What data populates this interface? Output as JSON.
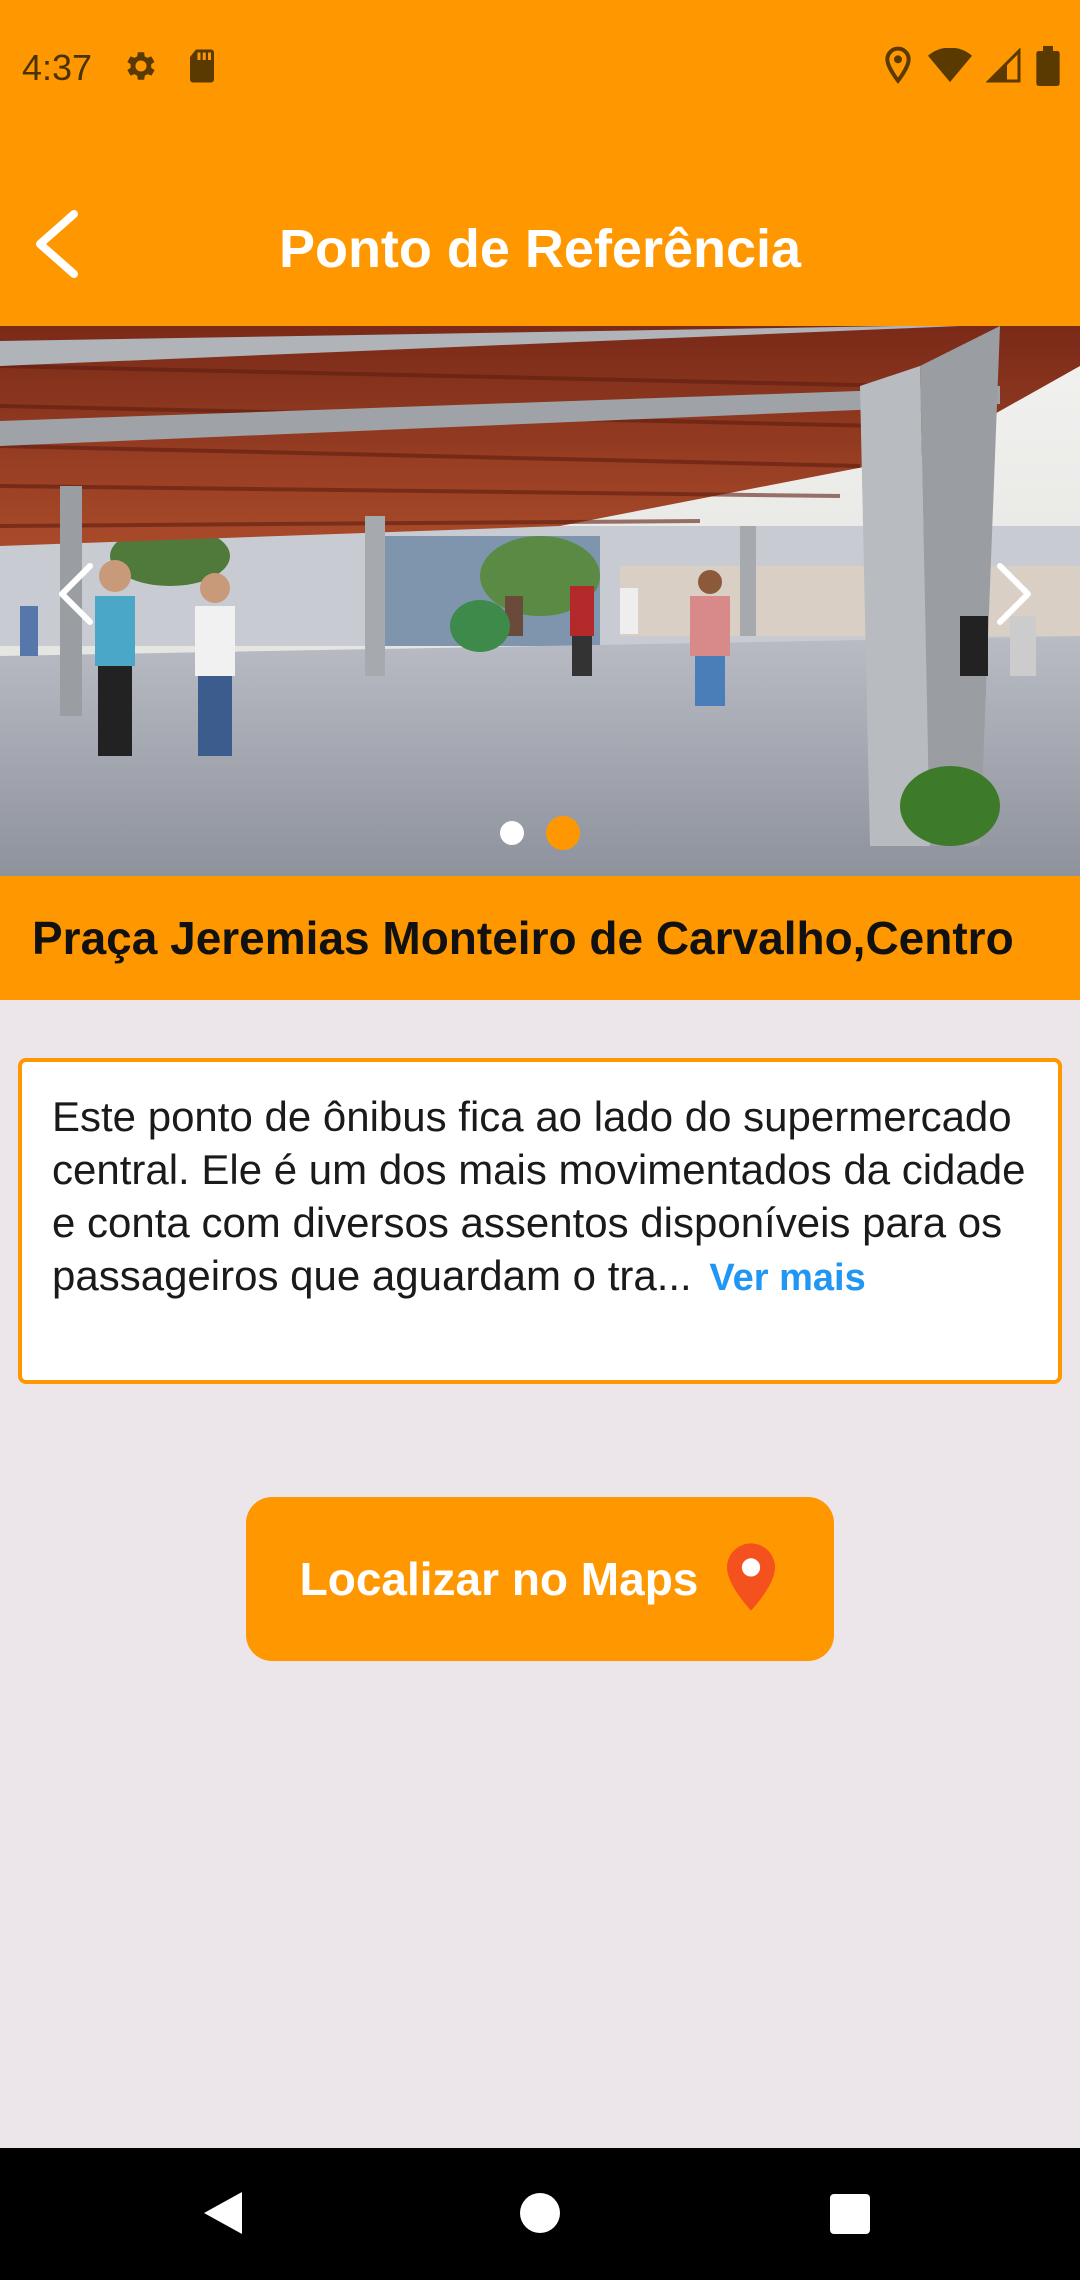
{
  "status_bar": {
    "time": "4:37",
    "icons_left": [
      "settings-icon",
      "sd-card-icon"
    ],
    "icons_right": [
      "location-icon",
      "wifi-icon",
      "signal-icon",
      "battery-icon"
    ]
  },
  "app_bar": {
    "title": "Ponto de Referência",
    "back_icon": "chevron-left-icon"
  },
  "carousel": {
    "image_description": "Covered wooden pergola plaza with people walking",
    "prev_icon": "chevron-left-icon",
    "next_icon": "chevron-right-icon",
    "page_count": 2,
    "active_index": 1
  },
  "place": {
    "title": "Praça Jeremias Monteiro de Carvalho,Centro"
  },
  "description": {
    "text": "Este ponto de ônibus fica ao lado do supermercado central. Ele é um dos mais movimentados da cidade e conta com diversos assentos disponíveis para os passageiros que aguardam o tra...",
    "more_label": "Ver mais"
  },
  "maps_button": {
    "label": "Localizar no Maps",
    "icon": "map-pin-icon"
  },
  "colors": {
    "primary": "#FF9800",
    "background": "#ECE6EB",
    "link": "#2196F3",
    "pin": "#F4511E"
  },
  "nav_bar": {
    "buttons": [
      "back-triangle-icon",
      "home-circle-icon",
      "recents-square-icon"
    ]
  }
}
